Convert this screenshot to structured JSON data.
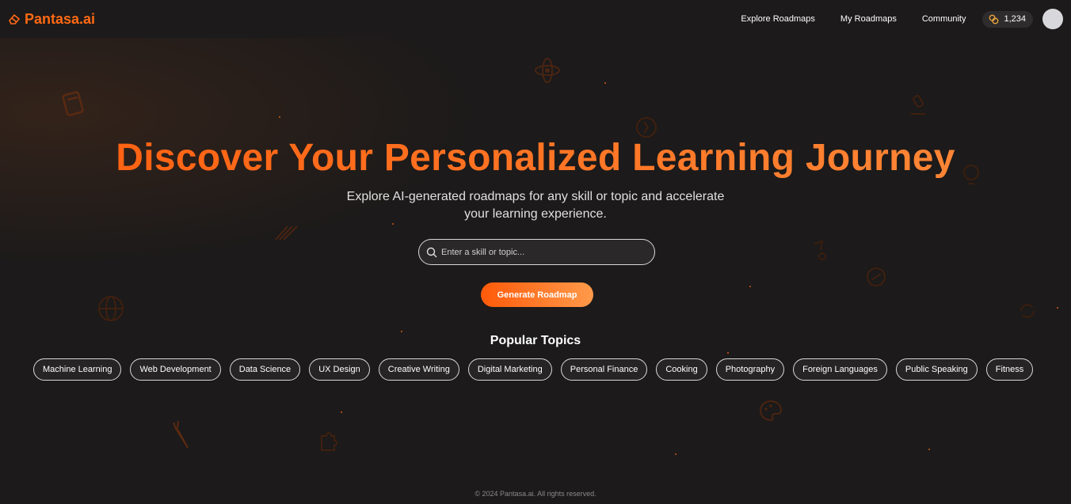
{
  "brand": {
    "name": "Pantasa.ai",
    "color": "#ff6a14",
    "logo_icon": "eraser-icon"
  },
  "nav": {
    "links": [
      "Explore Roadmaps",
      "My Roadmaps",
      "Community"
    ],
    "credits": {
      "icon": "coins-icon",
      "value": "1,234"
    },
    "avatar": "avatar"
  },
  "hero": {
    "title": "Discover Your Personalized Learning Journey",
    "subtitle": "Explore AI-generated roadmaps for any skill or topic and accelerate your learning experience.",
    "search": {
      "icon": "search-icon",
      "placeholder": "Enter a skill or topic...",
      "value": ""
    },
    "button_label": "Generate Roadmap"
  },
  "popular": {
    "title": "Popular Topics",
    "topics": [
      "Machine Learning",
      "Web Development",
      "Data Science",
      "UX Design",
      "Creative Writing",
      "Digital Marketing",
      "Personal Finance",
      "Cooking",
      "Photography",
      "Foreign Languages",
      "Public Speaking",
      "Fitness"
    ]
  },
  "footer": {
    "text": "© 2024 Pantasa.ai. All rights reserved."
  },
  "colors": {
    "background": "#1c1a1a",
    "accent": "#ff6a14",
    "accent_light": "#ff9a4a"
  },
  "decorative_icons": [
    "book-icon",
    "atom-icon",
    "globe-icon",
    "microscope-icon",
    "lightbulb-icon",
    "palette-icon",
    "carrot-icon",
    "puzzle-icon",
    "music-icon",
    "code-icon"
  ]
}
